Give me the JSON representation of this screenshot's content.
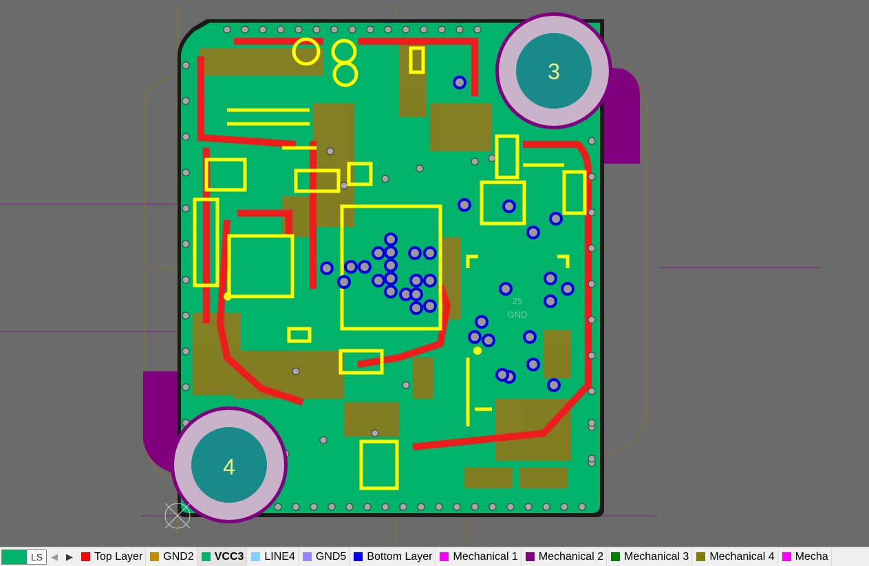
{
  "pcb": {
    "hole_labels": [
      "3",
      "4"
    ],
    "silk_text": [
      "25",
      "GND"
    ]
  },
  "layer_bar": {
    "ls_label": "LS",
    "prev_icon": "chevron-left-icon",
    "next_icon": "chevron-right-icon",
    "tabs": [
      {
        "label": "Top Layer",
        "color": "#ff0000"
      },
      {
        "label": "GND2",
        "color": "#bc8e00"
      },
      {
        "label": "VCC3",
        "color": "#00b36b",
        "active": true
      },
      {
        "label": "LINE4",
        "color": "#7fcfff"
      },
      {
        "label": "GND5",
        "color": "#9a7fff"
      },
      {
        "label": "Bottom Layer",
        "color": "#0000ff"
      },
      {
        "label": "Mechanical 1",
        "color": "#ff00ff"
      },
      {
        "label": "Mechanical 2",
        "color": "#800080"
      },
      {
        "label": "Mechanical 3",
        "color": "#008000"
      },
      {
        "label": "Mechanical 4",
        "color": "#808000"
      },
      {
        "label": "Mecha",
        "color": "#ff00ff"
      }
    ]
  }
}
